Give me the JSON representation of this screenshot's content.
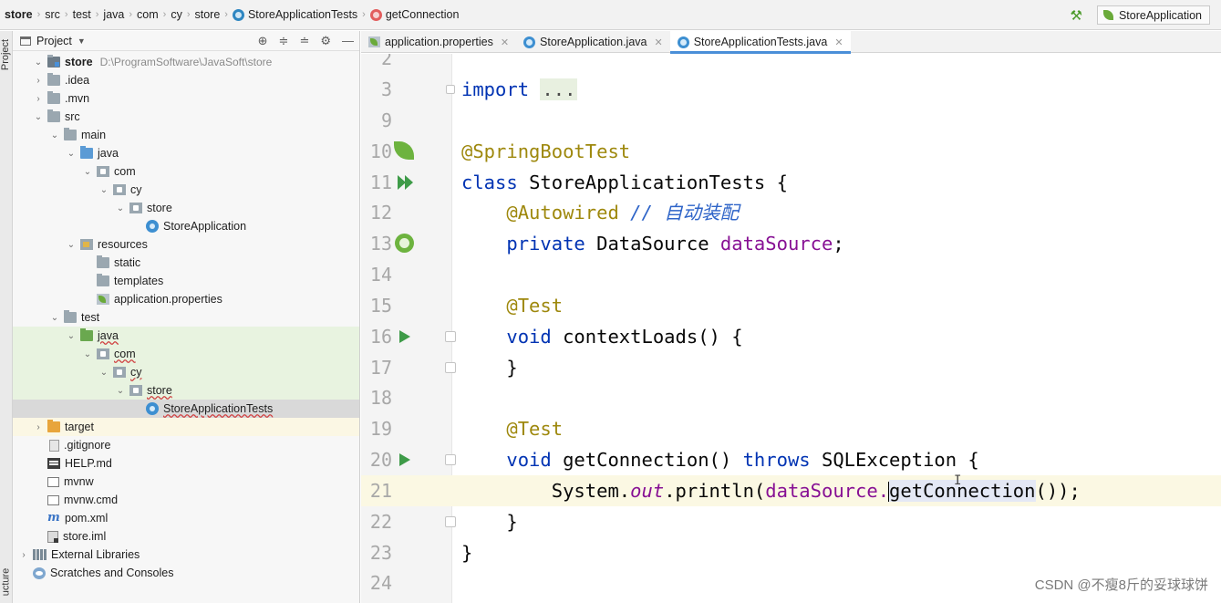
{
  "breadcrumb": [
    "store",
    "src",
    "test",
    "java",
    "com",
    "cy",
    "store",
    "StoreApplicationTests",
    "getConnection"
  ],
  "run_config": "StoreApplication",
  "project_panel": {
    "title": "Project",
    "stripe_tabs": [
      "Project",
      "ucture"
    ]
  },
  "tree": [
    {
      "label": "store",
      "path": "D:\\ProgramSoftware\\JavaSoft\\store",
      "icon": "module-folder-icon",
      "arrow": "v"
    },
    {
      "label": ".idea",
      "icon": "folder-icon",
      "arrow": ">"
    },
    {
      "label": ".mvn",
      "icon": "folder-icon",
      "arrow": ">"
    },
    {
      "label": "src",
      "icon": "folder-icon",
      "arrow": "v"
    },
    {
      "label": "main",
      "icon": "folder-icon",
      "arrow": "v"
    },
    {
      "label": "java",
      "icon": "source-folder-icon",
      "arrow": "v"
    },
    {
      "label": "com",
      "icon": "package-icon",
      "arrow": "v"
    },
    {
      "label": "cy",
      "icon": "package-icon",
      "arrow": "v"
    },
    {
      "label": "store",
      "icon": "package-icon",
      "arrow": "v"
    },
    {
      "label": "StoreApplication",
      "icon": "class-icon",
      "arrow": ""
    },
    {
      "label": "resources",
      "icon": "resources-folder-icon",
      "arrow": "v"
    },
    {
      "label": "static",
      "icon": "folder-icon",
      "arrow": ""
    },
    {
      "label": "templates",
      "icon": "folder-icon",
      "arrow": ""
    },
    {
      "label": "application.properties",
      "icon": "properties-icon",
      "arrow": ""
    },
    {
      "label": "test",
      "icon": "folder-icon",
      "arrow": "v"
    },
    {
      "label": "java",
      "icon": "test-folder-icon",
      "arrow": "v"
    },
    {
      "label": "com",
      "icon": "package-icon",
      "arrow": "v"
    },
    {
      "label": "cy",
      "icon": "package-icon",
      "arrow": "v"
    },
    {
      "label": "store",
      "icon": "package-icon",
      "arrow": "v"
    },
    {
      "label": "StoreApplicationTests",
      "icon": "class-icon",
      "arrow": ""
    },
    {
      "label": "target",
      "icon": "excluded-folder-icon",
      "arrow": ">"
    },
    {
      "label": ".gitignore",
      "icon": "file-icon",
      "arrow": ""
    },
    {
      "label": "HELP.md",
      "icon": "markdown-icon",
      "arrow": ""
    },
    {
      "label": "mvnw",
      "icon": "script-icon",
      "arrow": ""
    },
    {
      "label": "mvnw.cmd",
      "icon": "script-icon",
      "arrow": ""
    },
    {
      "label": "pom.xml",
      "icon": "maven-icon",
      "arrow": ""
    },
    {
      "label": "store.iml",
      "icon": "iml-icon",
      "arrow": ""
    },
    {
      "label": "External Libraries",
      "icon": "library-icon",
      "arrow": ">"
    },
    {
      "label": "Scratches and Consoles",
      "icon": "scratch-icon",
      "arrow": ""
    }
  ],
  "tabs": [
    {
      "label": "application.properties",
      "active": false
    },
    {
      "label": "StoreApplication.java",
      "active": false
    },
    {
      "label": "StoreApplicationTests.java",
      "active": true
    }
  ],
  "editor": {
    "line_numbers": [
      "2",
      "3",
      "9",
      "10",
      "11",
      "12",
      "13",
      "14",
      "15",
      "16",
      "17",
      "18",
      "19",
      "20",
      "21",
      "22",
      "23",
      "24"
    ],
    "code": {
      "import_kw": "import",
      "import_fold": "...",
      "spring_boot_test": "@SpringBootTest",
      "class_kw": "class",
      "class_name": "StoreApplicationTests {",
      "autowired": "@Autowired",
      "comment": "// 自动装配",
      "private_kw": "private",
      "datasource_type": "DataSource",
      "datasource_field": "dataSource",
      "semicolon": ";",
      "test_ann_1": "@Test",
      "void_kw_1": "void",
      "context_loads": "contextLoads() {",
      "close_brace_1": "}",
      "test_ann_2": "@Test",
      "void_kw_2": "void",
      "get_connection_sig": "getConnection()",
      "throws_kw": "throws",
      "sql_exception": "SQLException {",
      "println_prefix": "System.",
      "out_field": "out",
      "println_call": ".println(",
      "datasource_ref": "dataSource.",
      "get_connection_call": "getConnection",
      "println_suffix": "());",
      "close_brace_2": "}",
      "close_brace_3": "}"
    }
  },
  "watermark": "CSDN @不瘦8斤的妥球球饼"
}
